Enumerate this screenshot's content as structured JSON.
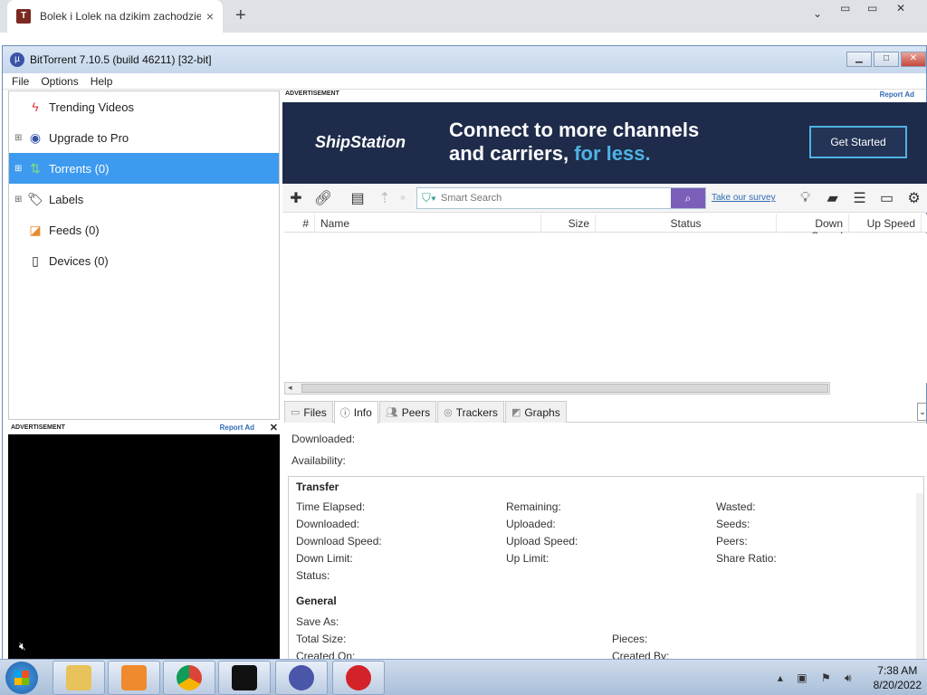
{
  "browser": {
    "tab_title": "Bolek i Lolek na dzikim zachodzie",
    "tab_close": "×",
    "new_tab": "+"
  },
  "window": {
    "title": "BitTorrent 7.10.5  (build 46211) [32-bit]"
  },
  "menu": [
    "File",
    "Options",
    "Help"
  ],
  "sidebar": {
    "items": [
      {
        "label": "Trending Videos",
        "icon": "lightning-icon"
      },
      {
        "label": "Upgrade to Pro",
        "icon": "bittorrent-logo-icon"
      },
      {
        "label": "Torrents (0)",
        "icon": "torrents-icon"
      },
      {
        "label": "Labels",
        "icon": "tag-icon"
      },
      {
        "label": "Feeds (0)",
        "icon": "rss-icon"
      },
      {
        "label": "Devices (0)",
        "icon": "device-icon"
      }
    ]
  },
  "ads": {
    "label": "ADVERTISEMENT",
    "report": "Report Ad",
    "banner_brand": "ShipStation",
    "banner_line1": "Connect to more channels",
    "banner_line2a": "and carriers, ",
    "banner_line2b": "for less.",
    "banner_cta": "Get Started"
  },
  "toolbar": {
    "search_placeholder": "Smart Search",
    "survey": "Take our survey"
  },
  "list_columns": [
    "#",
    "Name",
    "Size",
    "Status",
    "Down Speed",
    "Up Speed"
  ],
  "tabs": [
    "Files",
    "Info",
    "Peers",
    "Trackers",
    "Graphs"
  ],
  "info": {
    "downloaded": "Downloaded:",
    "availability": "Availability:",
    "transfer_title": "Transfer",
    "transfer": {
      "col1": [
        "Time Elapsed:",
        "Downloaded:",
        "Download Speed:",
        "Down Limit:",
        "Status:"
      ],
      "col2": [
        "Remaining:",
        "Uploaded:",
        "Upload Speed:",
        "Up Limit:"
      ],
      "col3": [
        "Wasted:",
        "Seeds:",
        "Peers:",
        "Share Ratio:"
      ]
    },
    "general_title": "General",
    "general": {
      "save_as": "Save As:",
      "total_size": "Total Size:",
      "created_on": "Created On:",
      "pieces": "Pieces:",
      "created_by": "Created By:"
    }
  },
  "taskbar": {
    "time": "7:38 AM",
    "date": "8/20/2022"
  }
}
